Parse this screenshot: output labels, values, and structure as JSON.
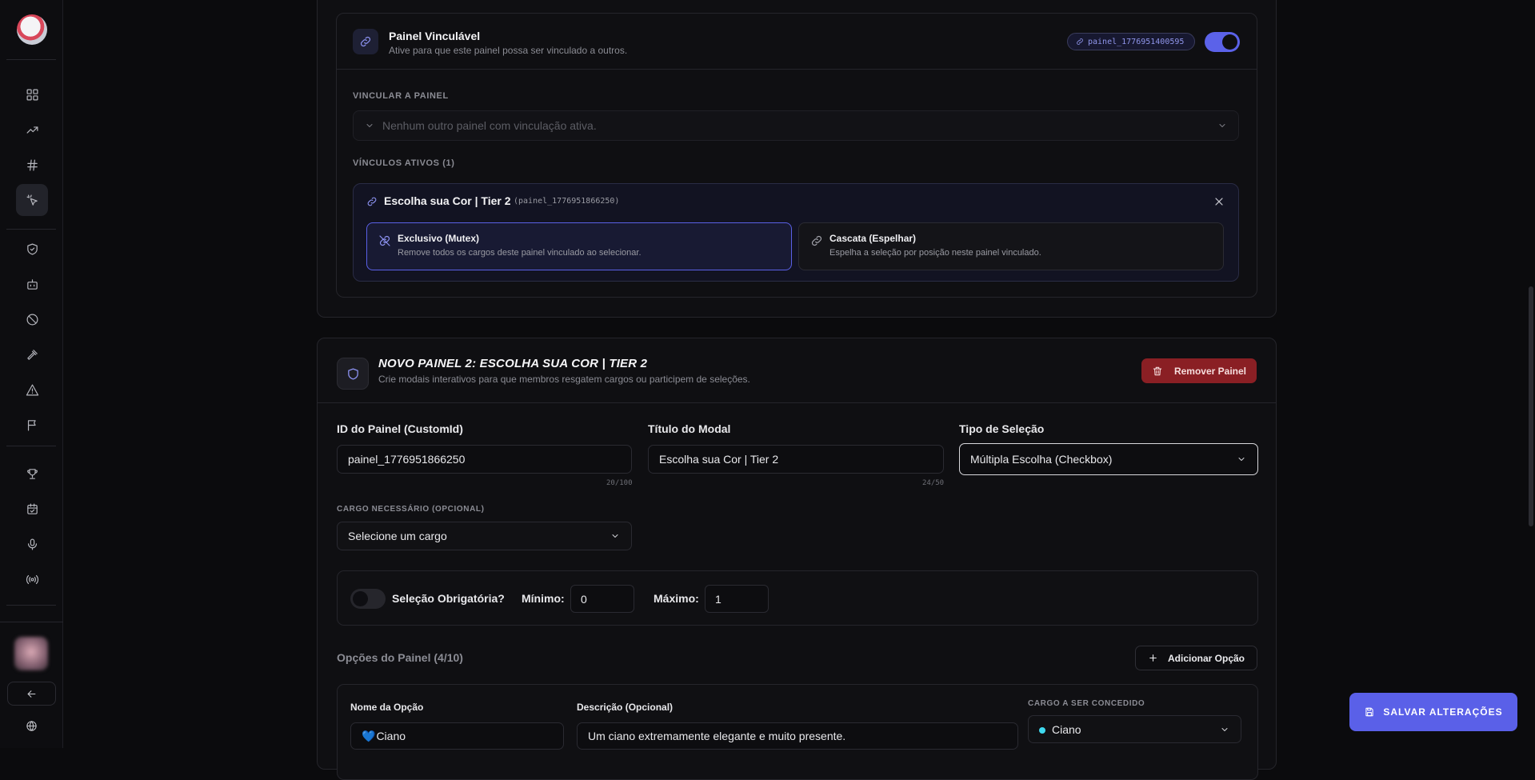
{
  "sidebar": {
    "items": [
      {
        "icon": "dashboard-icon"
      },
      {
        "icon": "trending-icon"
      },
      {
        "icon": "hash-icon"
      },
      {
        "icon": "cursor-click-icon",
        "active": true
      },
      {
        "icon": "shield-check-icon"
      },
      {
        "icon": "bot-icon"
      },
      {
        "icon": "ban-icon"
      },
      {
        "icon": "gavel-icon"
      },
      {
        "icon": "warning-icon"
      },
      {
        "icon": "flag-icon"
      },
      {
        "icon": "trophy-icon"
      },
      {
        "icon": "calendar-check-icon"
      },
      {
        "icon": "microphone-icon"
      },
      {
        "icon": "broadcast-icon"
      }
    ]
  },
  "linkable": {
    "title": "Painel Vinculável",
    "subtitle": "Ative para que este painel possa ser vinculado a outros.",
    "panel_id_chip": "painel_1776951400595",
    "enabled": true,
    "link_to_label": "VINCULAR A PAINEL",
    "link_to_placeholder": "Nenhum outro painel com vinculação ativa.",
    "active_links_label": "VÍNCULOS ATIVOS (1)",
    "active_link": {
      "title": "Escolha sua Cor | Tier 2",
      "id": "(painel_1776951866250)",
      "modes": [
        {
          "title": "Exclusivo (Mutex)",
          "desc": "Remove todos os cargos deste painel vinculado ao selecionar.",
          "selected": true
        },
        {
          "title": "Cascata (Espelhar)",
          "desc": "Espelha a seleção por posição neste painel vinculado.",
          "selected": false
        }
      ]
    }
  },
  "panel": {
    "title": "NOVO PAINEL 2: ESCOLHA SUA COR | TIER 2",
    "subtitle": "Crie modais interativos para que membros resgatem cargos ou participem de seleções.",
    "remove_label": "Remover Painel",
    "fields": {
      "custom_id_label": "ID do Painel (CustomId)",
      "custom_id_value": "painel_1776951866250",
      "custom_id_count": "20/100",
      "modal_title_label": "Título do Modal",
      "modal_title_value": "Escolha sua Cor | Tier 2",
      "modal_title_count": "24/50",
      "selection_type_label": "Tipo de Seleção",
      "selection_type_value": "Múltipla Escolha (Checkbox)",
      "required_role_label": "CARGO NECESSÁRIO (OPCIONAL)",
      "required_role_value": "Selecione um cargo"
    },
    "selection": {
      "required_label": "Seleção Obrigatória?",
      "required": false,
      "min_label": "Mínimo:",
      "min_value": "0",
      "max_label": "Máximo:",
      "max_value": "1"
    },
    "options": {
      "title": "Opções do Painel (4/10)",
      "add_label": "Adicionar Opção",
      "first": {
        "name_label": "Nome da Opção",
        "name_emoji": "💙",
        "name_value": "Ciano",
        "desc_label": "Descrição (Opcional)",
        "desc_value": "Um ciano extremamente elegante e muito presente.",
        "role_label": "CARGO A SER CONCEDIDO",
        "role_value": "Ciano",
        "role_color": "#3fd9ef"
      }
    }
  },
  "save_label": "SALVAR ALTERAÇÕES",
  "colors": {
    "accent": "#5a60e8",
    "danger": "#8a1f24"
  }
}
